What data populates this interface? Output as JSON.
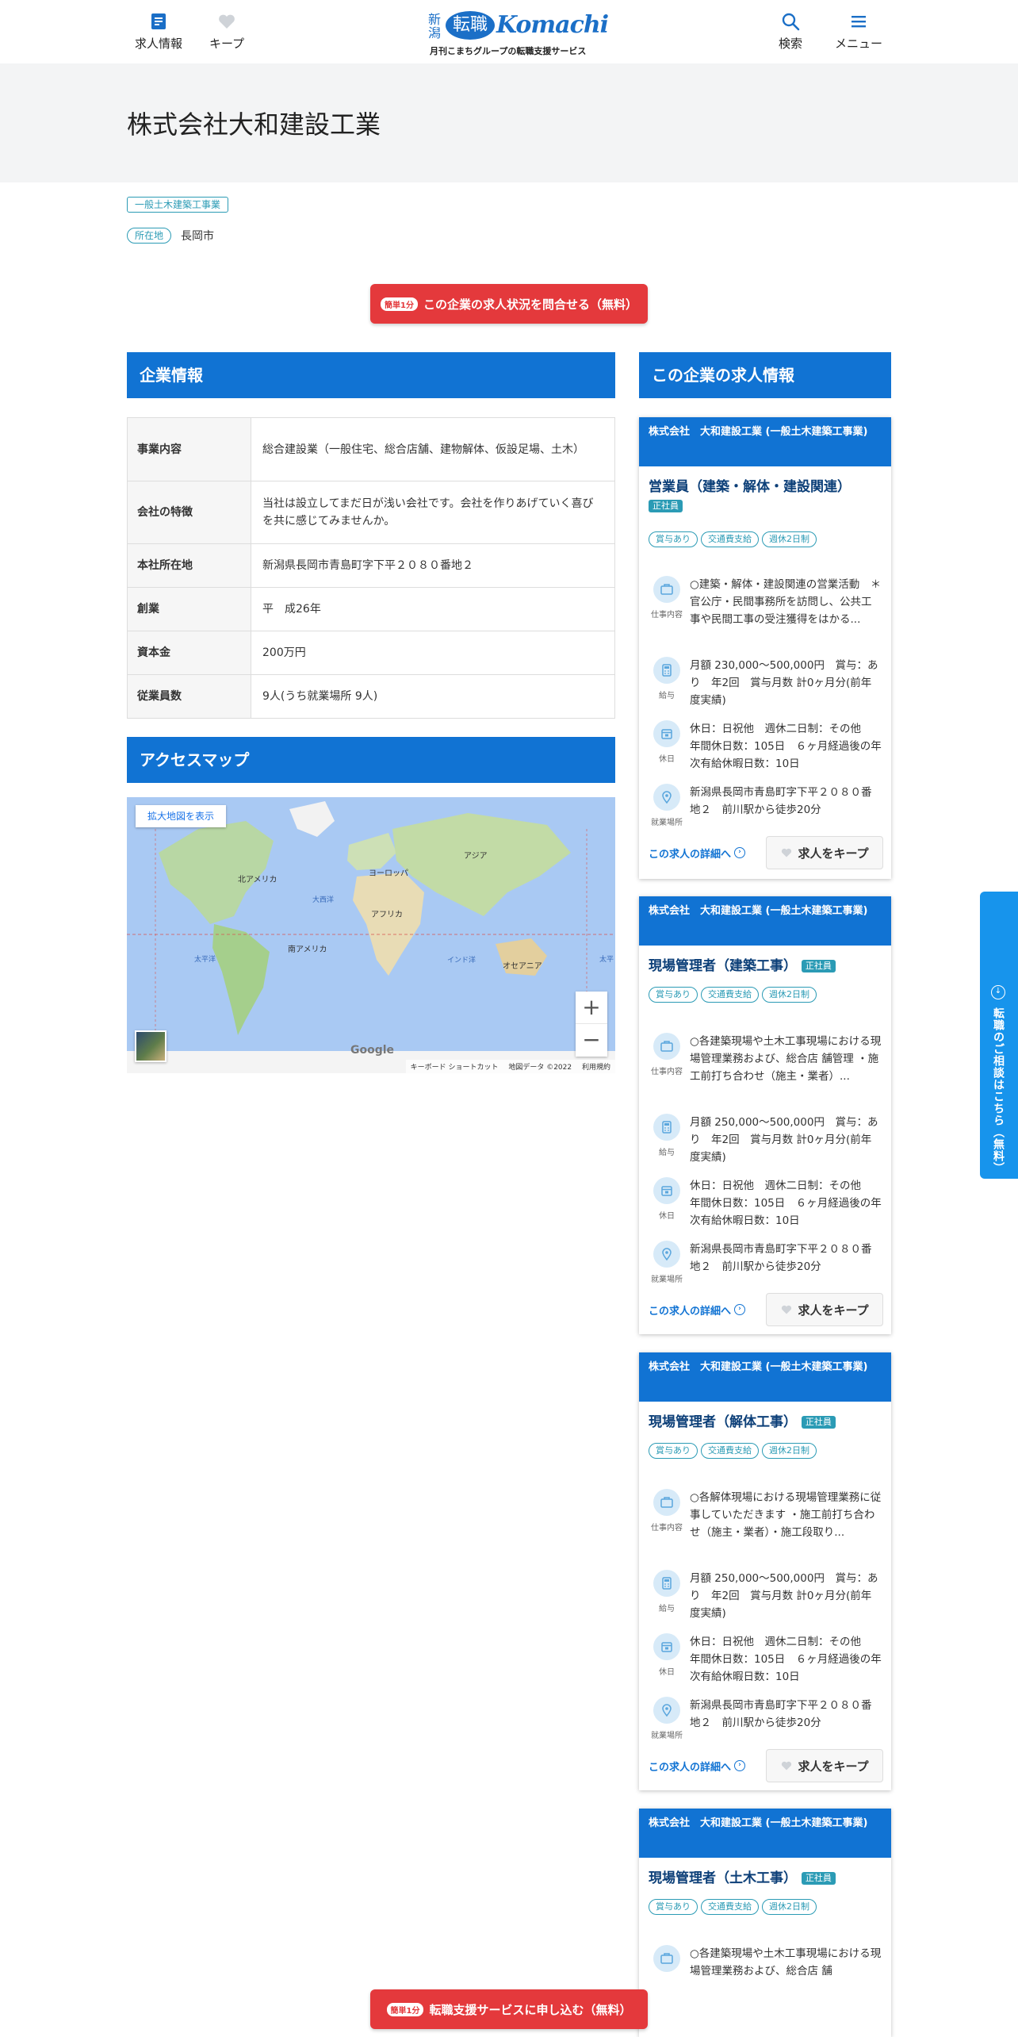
{
  "header": {
    "nav_left": [
      {
        "label": "求人情報",
        "icon": "job-list-icon"
      },
      {
        "label": "キープ",
        "icon": "heart-icon"
      }
    ],
    "logo": {
      "region": "新潟",
      "badge": "転職",
      "word": "Komachi",
      "tagline": "月刊こまちグループの転職支援サービス"
    },
    "nav_right": [
      {
        "label": "検索",
        "icon": "search-icon"
      },
      {
        "label": "メニュー",
        "icon": "hamburger-icon"
      }
    ]
  },
  "company": {
    "name": "株式会社大和建設工業",
    "industry": "一般土木建築工事業",
    "location_label": "所在地",
    "location": "長岡市"
  },
  "inquire_button": {
    "badge": "簡単1分",
    "label": "この企業の求人状況を問合せる（無料）"
  },
  "company_info": {
    "heading": "企業情報",
    "rows": [
      {
        "key": "事業内容",
        "value": "総合建設業（一般住宅、総合店舗、建物解体、仮設足場、土木）"
      },
      {
        "key": "会社の特徴",
        "value": "当社は設立してまだ日が浅い会社です。会社を作りあげていく喜びを共に感じてみませんか。"
      },
      {
        "key": "本社所在地",
        "value": "新潟県長岡市青島町字下平２０８０番地２"
      },
      {
        "key": "創業",
        "value": "平　成26年"
      },
      {
        "key": "資本金",
        "value": "200万円"
      },
      {
        "key": "従業員数",
        "value": "9人(うち就業場所 9人)"
      }
    ]
  },
  "access_map": {
    "heading": "アクセスマップ",
    "enlarge_label": "拡大地図を表示",
    "labels": [
      "北アメリカ",
      "ヨーロッパ",
      "アジア",
      "大西洋",
      "アフリカ",
      "南アメリカ",
      "太平洋",
      "インド洋",
      "オセアニア",
      "太平"
    ],
    "google": "Google",
    "footer": [
      "キーボード ショートカット",
      "地図データ ©2022",
      "利用規約"
    ],
    "zoom_in": "+",
    "zoom_out": "−"
  },
  "jobs_heading": "この企業の求人情報",
  "job_row_labels": {
    "work": "仕事内容",
    "salary": "給与",
    "holiday": "休日",
    "place": "就業場所"
  },
  "jobs": [
    {
      "company": "株式会社　大和建設工業 (一般土木建築工事業)",
      "title": "営業員（建築・解体・建設関連）",
      "employment": "正社員",
      "benefits": [
        "賞与あり",
        "交通費支給",
        "週休2日制"
      ],
      "work": "○建築・解体・建設関連の営業活動　＊官公庁・民間事務所を訪問し、公共工事や民間工事の受注獲得をはかる...",
      "salary": "月額 230,000～500,000円　賞与：あり　年2回　賞与月数 計0ヶ月分(前年度実績)",
      "holiday": "休日：日祝他　週休二日制：その他　年間休日数：105日　６ヶ月経過後の年次有給休暇日数：10日",
      "place": "新潟県長岡市青島町字下平２０８０番地２　前川駅から徒歩20分",
      "detail_label": "この求人の詳細へ",
      "keep_label": "求人をキープ"
    },
    {
      "company": "株式会社　大和建設工業 (一般土木建築工事業)",
      "title": "現場管理者（建築工事）",
      "employment": "正社員",
      "benefits": [
        "賞与あり",
        "交通費支給",
        "週休2日制"
      ],
      "work": "○各建築現場や土木工事現場における現場管理業務および、総合店 舗管理 ・施工前打ち合わせ（施主・業者）...",
      "salary": "月額 250,000～500,000円　賞与：あり　年2回　賞与月数 計0ヶ月分(前年度実績)",
      "holiday": "休日：日祝他　週休二日制：その他　年間休日数：105日　６ヶ月経過後の年次有給休暇日数：10日",
      "place": "新潟県長岡市青島町字下平２０８０番地２　前川駅から徒歩20分",
      "detail_label": "この求人の詳細へ",
      "keep_label": "求人をキープ"
    },
    {
      "company": "株式会社　大和建設工業 (一般土木建築工事業)",
      "title": "現場管理者（解体工事）",
      "employment": "正社員",
      "benefits": [
        "賞与あり",
        "交通費支給",
        "週休2日制"
      ],
      "work": "○各解体現場における現場管理業務に従事していただきます ・施工前打ち合わせ（施主・業者）・施工段取り...",
      "salary": "月額 250,000～500,000円　賞与：あり　年2回　賞与月数 計0ヶ月分(前年度実績)",
      "holiday": "休日：日祝他　週休二日制：その他　年間休日数：105日　６ヶ月経過後の年次有給休暇日数：10日",
      "place": "新潟県長岡市青島町字下平２０８０番地２　前川駅から徒歩20分",
      "detail_label": "この求人の詳細へ",
      "keep_label": "求人をキープ"
    },
    {
      "company": "株式会社　大和建設工業 (一般土木建築工事業)",
      "title": "現場管理者（土木工事）",
      "employment": "正社員",
      "benefits": [
        "賞与あり",
        "交通費支給",
        "週休2日制"
      ],
      "work": "○各建築現場や土木工事現場における現場管理業務および、総合店 舗"
    }
  ],
  "side_tab": {
    "label": "転職のご相談はこちら（無料）"
  },
  "apply_button": {
    "badge": "簡単1分",
    "label": "転職支援サービスに申し込む（無料）"
  }
}
